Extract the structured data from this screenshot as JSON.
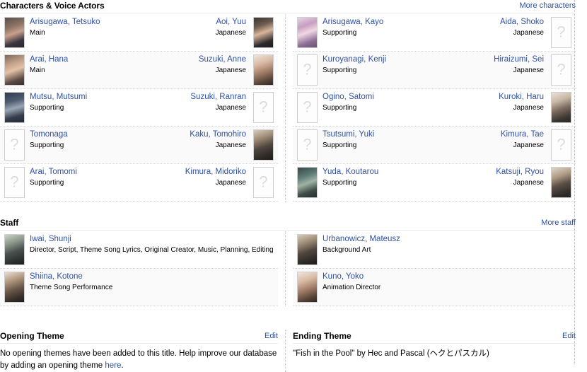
{
  "colors": {
    "link": "#2e51a2",
    "row_alt_bg": "#fafafa",
    "border": "#d8d8d8",
    "page_bg": "#ffffff"
  },
  "characters_section": {
    "title": "Characters & Voice Actors",
    "more_link": "More characters",
    "language_label": "Japanese",
    "left_column": [
      {
        "character": "Arisugawa, Tetsuko",
        "role": "Main",
        "actor": "Aoi, Yuu",
        "lang": "Japanese",
        "char_img": "photo",
        "char_swatch": "p0",
        "actor_img": "photo",
        "actor_swatch": "p3"
      },
      {
        "character": "Arai, Hana",
        "role": "Main",
        "actor": "Suzuki, Anne",
        "lang": "Japanese",
        "char_img": "photo",
        "char_swatch": "p1",
        "actor_img": "photo",
        "actor_swatch": "p11"
      },
      {
        "character": "Mutsu, Mutsumi",
        "role": "Supporting",
        "actor": "Suzuki, Ranran",
        "lang": "Japanese",
        "char_img": "photo",
        "char_swatch": "p2",
        "actor_img": "placeholder",
        "actor_swatch": ""
      },
      {
        "character": "Tomonaga",
        "role": "Supporting",
        "actor": "Kaku, Tomohiro",
        "lang": "Japanese",
        "char_img": "placeholder",
        "char_swatch": "",
        "actor_img": "photo",
        "actor_swatch": "p8"
      },
      {
        "character": "Arai, Tomomi",
        "role": "Supporting",
        "actor": "Kimura, Midoriko",
        "lang": "Japanese",
        "char_img": "placeholder",
        "char_swatch": "",
        "actor_img": "placeholder",
        "actor_swatch": ""
      }
    ],
    "right_column": [
      {
        "character": "Arisugawa, Kayo",
        "role": "Supporting",
        "actor": "Aida, Shoko",
        "lang": "Japanese",
        "char_img": "photo",
        "char_swatch": "p4",
        "actor_img": "placeholder",
        "actor_swatch": ""
      },
      {
        "character": "Kuroyanagi, Kenji",
        "role": "Supporting",
        "actor": "Hiraizumi, Sei",
        "lang": "Japanese",
        "char_img": "placeholder",
        "char_swatch": "",
        "actor_img": "placeholder",
        "actor_swatch": ""
      },
      {
        "character": "Ogino, Satomi",
        "role": "Supporting",
        "actor": "Kuroki, Haru",
        "lang": "Japanese",
        "char_img": "placeholder",
        "char_swatch": "",
        "actor_img": "photo",
        "actor_swatch": "p5"
      },
      {
        "character": "Tsutsumi, Yuki",
        "role": "Supporting",
        "actor": "Kimura, Tae",
        "lang": "Japanese",
        "char_img": "placeholder",
        "char_swatch": "",
        "actor_img": "placeholder",
        "actor_swatch": ""
      },
      {
        "character": "Yuda, Koutarou",
        "role": "Supporting",
        "actor": "Katsuji, Ryou",
        "lang": "Japanese",
        "char_img": "photo",
        "char_swatch": "p7",
        "actor_img": "photo",
        "actor_swatch": "p6"
      }
    ]
  },
  "staff_section": {
    "title": "Staff",
    "more_link": "More staff",
    "left_column": [
      {
        "name": "Iwai, Shunji",
        "roles": "Director, Script, Theme Song Lyrics, Original Creator, Music, Planning, Editing",
        "img": "photo",
        "swatch": "p9"
      },
      {
        "name": "Shiina, Kotone",
        "roles": "Theme Song Performance",
        "img": "photo",
        "swatch": "p10"
      }
    ],
    "right_column": [
      {
        "name": "Urbanowicz, Mateusz",
        "roles": "Background Art",
        "img": "photo",
        "swatch": "p8"
      },
      {
        "name": "Kuno, Yoko",
        "roles": "Animation Director",
        "img": "photo",
        "swatch": "p11"
      }
    ]
  },
  "opening_theme": {
    "title": "Opening Theme",
    "edit_label": "Edit",
    "body_before": "No opening themes have been added to this title. Help improve our database by adding an opening theme ",
    "body_link": "here",
    "body_after": "."
  },
  "ending_theme": {
    "title": "Ending Theme",
    "edit_label": "Edit",
    "body": "\"Fish in the Pool\" by Hec and Pascal (ヘクとパスカル)"
  }
}
